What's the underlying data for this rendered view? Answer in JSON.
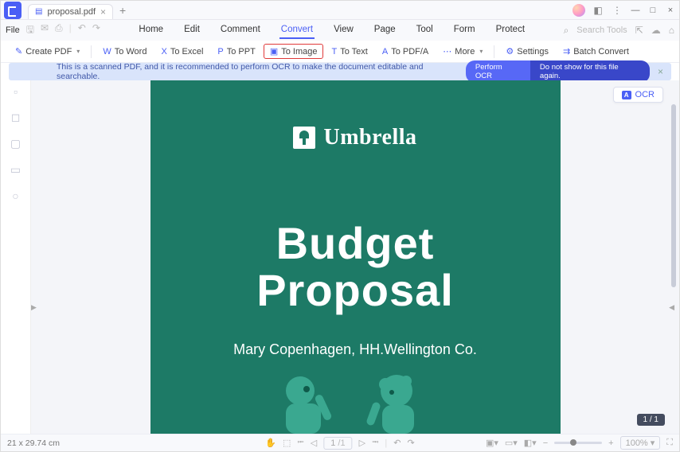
{
  "title": {
    "filename": "proposal.pdf"
  },
  "menu": {
    "file": "File",
    "items": [
      "Home",
      "Edit",
      "Comment",
      "Convert",
      "View",
      "Page",
      "Tool",
      "Form",
      "Protect"
    ],
    "active": "Convert",
    "search_placeholder": "Search Tools"
  },
  "ribbon": {
    "create": "Create PDF",
    "to_word": "To Word",
    "to_excel": "To Excel",
    "to_ppt": "To PPT",
    "to_image": "To Image",
    "to_text": "To Text",
    "to_pdfa": "To PDF/A",
    "more": "More",
    "settings": "Settings",
    "batch": "Batch Convert"
  },
  "notice": {
    "text": "This is a scanned PDF, and it is recommended to perform OCR to make the document editable and searchable.",
    "perform": "Perform OCR",
    "dismiss": "Do not show for this file again."
  },
  "ocr_chip": "OCR",
  "page_badge": "1 / 1",
  "document": {
    "brand": "Umbrella",
    "title_l1": "Budget",
    "title_l2": "Proposal",
    "subtitle": "Mary Copenhagen, HH.Wellington Co."
  },
  "status": {
    "dimensions": "21 x 29.74 cm",
    "page_current": "1",
    "page_total": "/1",
    "zoom": "100%"
  }
}
